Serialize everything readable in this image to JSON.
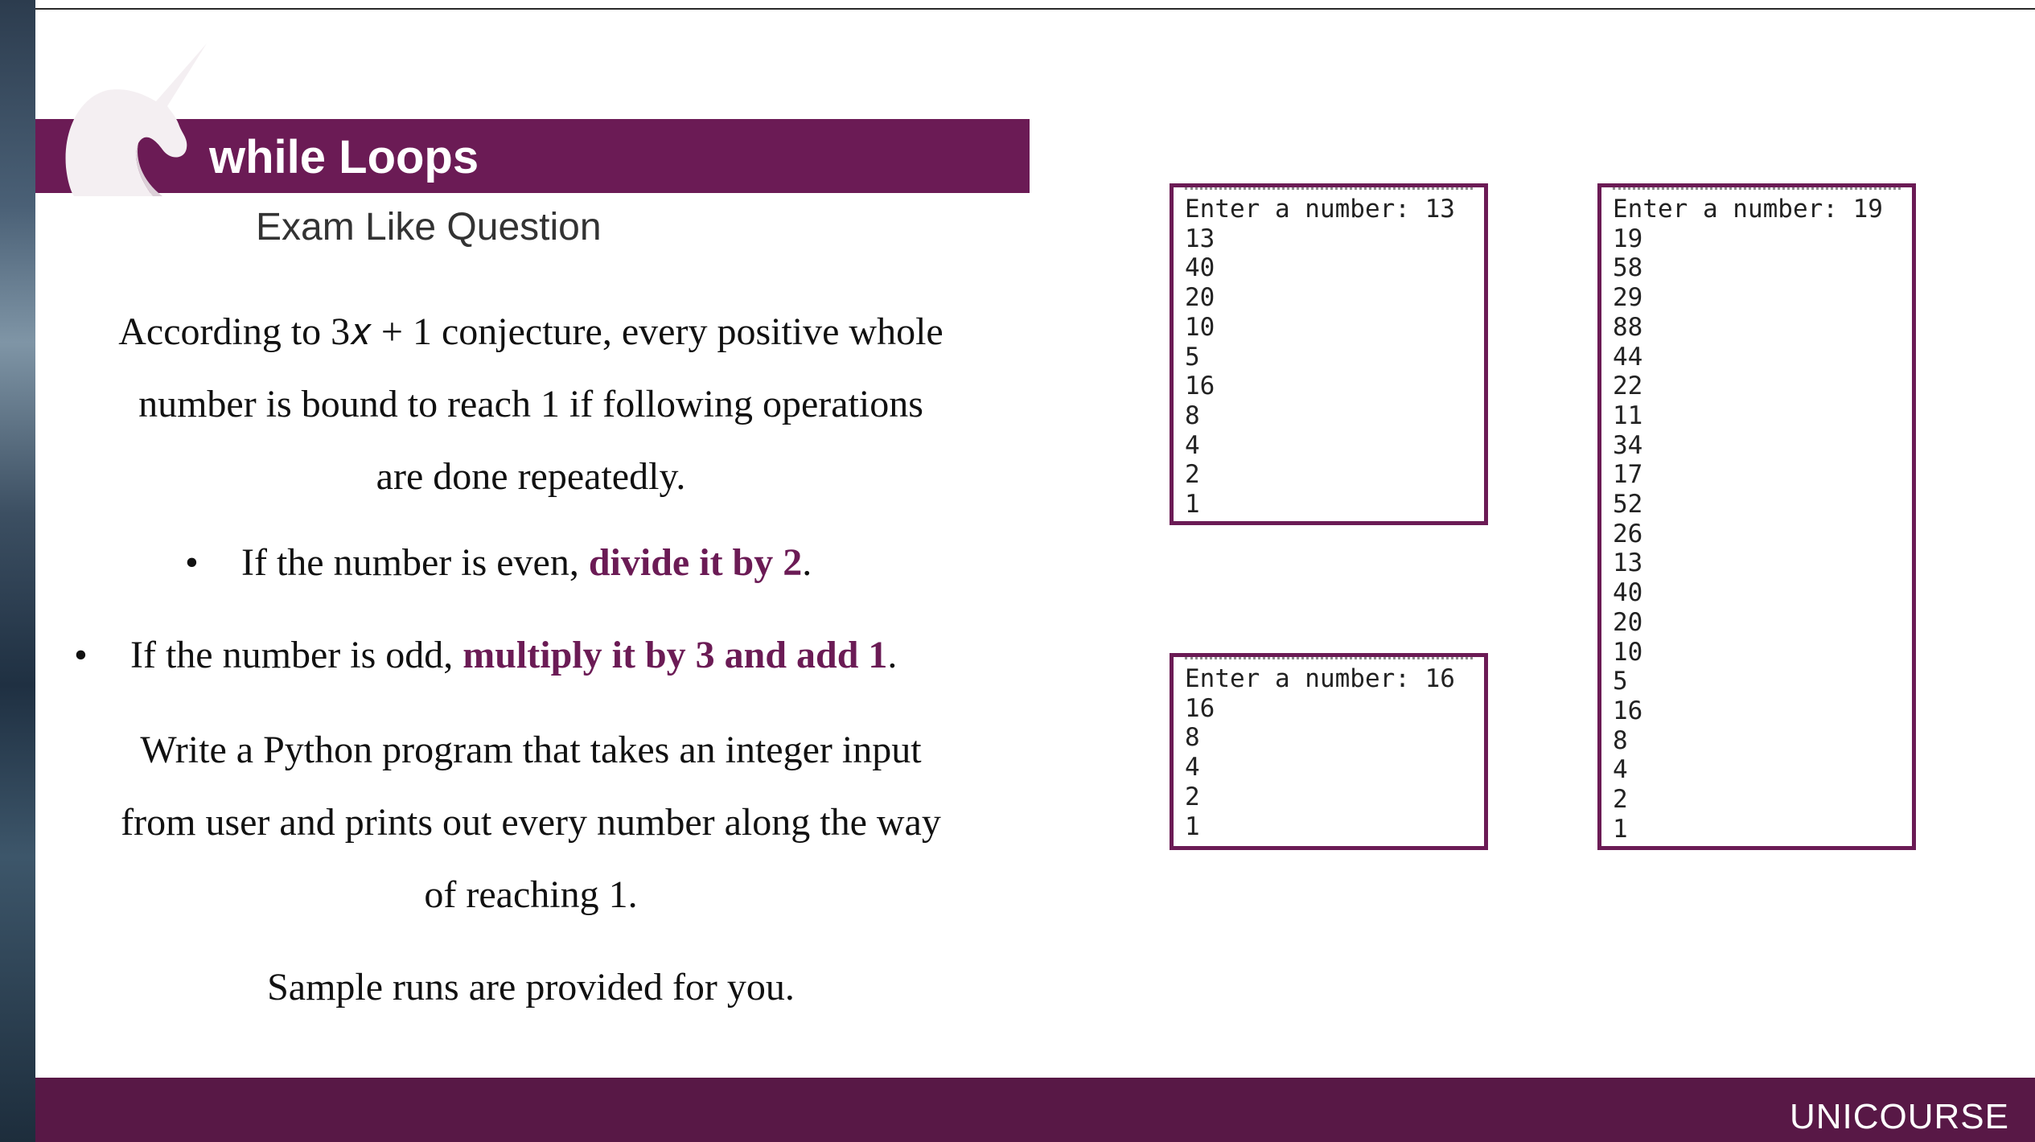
{
  "slide": {
    "title": "while Loops",
    "subtitle": "Exam Like Question",
    "intro_lines": [
      "According to 3𝑥 + 1 conjecture, every positive whole",
      "number is bound to reach 1 if following operations",
      "are done repeatedly."
    ],
    "bullets": [
      {
        "text": "If the number is even, ",
        "highlight": "divide it by 2",
        "end": "."
      },
      {
        "text": "If the number is odd, ",
        "highlight": "multiply it by 3 and add 1",
        "end": "."
      }
    ],
    "task_lines": [
      "Write a Python program that takes an integer input",
      "from user and prints out every number along the way",
      "of reaching 1."
    ],
    "closing": "Sample runs are provided for you.",
    "brand": "UNICOURSE",
    "bullet_glyph": "•"
  },
  "terminals": [
    {
      "prompt": "Enter a number: 13",
      "lines": [
        "13",
        "40",
        "20",
        "10",
        "5",
        "16",
        "8",
        "4",
        "2",
        "1"
      ]
    },
    {
      "prompt": "Enter a number: 16",
      "lines": [
        "16",
        "8",
        "4",
        "2",
        "1"
      ]
    },
    {
      "prompt": "Enter a number: 19",
      "lines": [
        "19",
        "58",
        "29",
        "88",
        "44",
        "22",
        "11",
        "34",
        "17",
        "52",
        "26",
        "13",
        "40",
        "20",
        "10",
        "5",
        "16",
        "8",
        "4",
        "2",
        "1"
      ]
    }
  ],
  "colors": {
    "accent": "#6b1b55",
    "footer": "#581846"
  },
  "icons": {
    "logo": "unicorn-logo-icon"
  }
}
